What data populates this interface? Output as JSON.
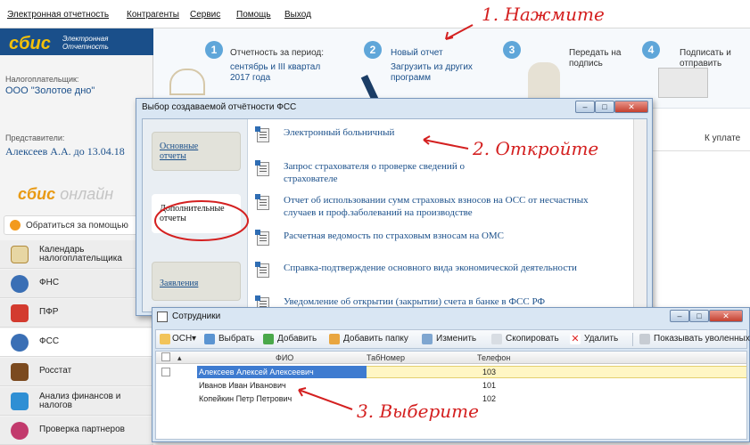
{
  "menu": [
    "Электронная отчетность",
    "Контрагенты",
    "Сервис",
    "Помощь",
    "Выход"
  ],
  "logo": {
    "brand": "сбис",
    "subtitle": "Электронная Отчетность",
    "online_brand": "сбис",
    "online_suffix": "онлайн"
  },
  "taxpayer": {
    "label": "Налогоплательщик:",
    "value": "ООО \"Золотое дно\""
  },
  "representative": {
    "label": "Представители:",
    "value": "Алексеев А.А. до 13.04.18"
  },
  "help_button": "Обратиться за помощью",
  "nav": [
    {
      "label": "Календарь налогоплательщика",
      "color": "#c9a24a"
    },
    {
      "label": "ФНС",
      "color": "#3a6fb5"
    },
    {
      "label": "ПФР",
      "color": "#d33b2f"
    },
    {
      "label": "ФСС",
      "color": "#3a6fb5"
    },
    {
      "label": "Росстат",
      "color": "#7b4a1f"
    },
    {
      "label": "Анализ финансов и налогов",
      "color": "#2f8fd4"
    },
    {
      "label": "Проверка партнеров",
      "color": "#c23a6d"
    }
  ],
  "steps": {
    "s1": {
      "num": "1",
      "title": "Отчетность за период:",
      "value": "сентябрь и III квартал 2017 года"
    },
    "s2": {
      "num": "2",
      "title": "Новый отчет",
      "value": "Загрузить из других программ"
    },
    "s3": {
      "num": "3",
      "title": "Передать на подпись"
    },
    "s4": {
      "num": "4",
      "title": "Подписать и отправить"
    }
  },
  "kuplate": "К уплате",
  "dialog1": {
    "title": "Выбор создаваемой отчётности ФСС",
    "tabs": [
      "Основные отчеты",
      "Дополнительные отчеты",
      "Заявления"
    ],
    "items": [
      "Электронный больничный",
      "Запрос страхователя о проверке сведений о страхователе",
      "Отчет об использовании сумм страховых взносов на ОСС от несчастных случаев и проф.заболеваний на производстве",
      "Расчетная ведомость по страховым взносам на ОМС",
      "Справка-подтверждение основного вида экономической деятельности",
      "Уведомление об открытии (закрытии) счета в банке в ФСС РФ"
    ]
  },
  "dialog2": {
    "title": "Сотрудники",
    "toolbar": [
      "ОСН",
      "Выбрать",
      "Добавить",
      "Добавить папку",
      "Изменить",
      "Скопировать",
      "Удалить",
      "Показывать уволенных"
    ],
    "columns": [
      "ФИО",
      "ТабНомер",
      "Телефон"
    ],
    "rows": [
      {
        "fio": "Алексеев Алексей Алексеевич",
        "tab": "",
        "phone": "103"
      },
      {
        "fio": "Иванов Иван Иванович",
        "tab": "",
        "phone": "101"
      },
      {
        "fio": "Копейкин Петр Петрович",
        "tab": "",
        "phone": "102"
      }
    ]
  },
  "annotations": [
    "1. Нажмите",
    "2. Откройте",
    "3. Выберите"
  ],
  "colors": {
    "annotation": "#d42020",
    "brand_blue": "#1a4f8a",
    "brand_yellow": "#f4c10a",
    "selection": "#3e7bd0"
  }
}
